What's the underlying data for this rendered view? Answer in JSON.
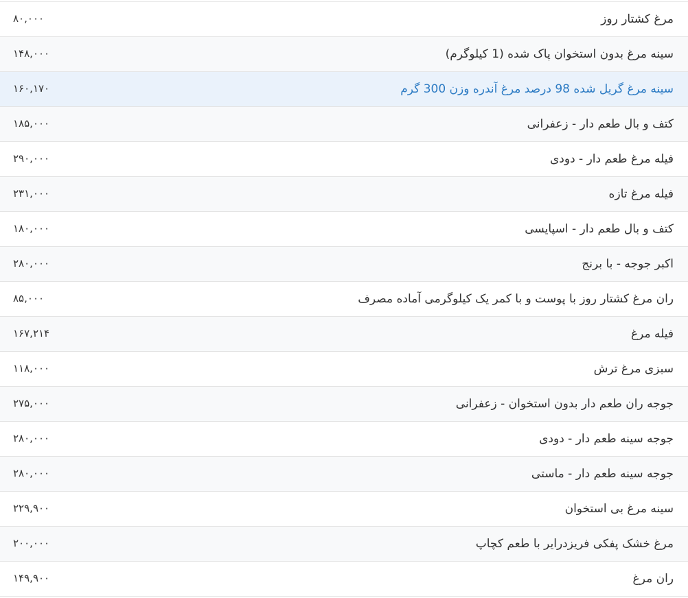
{
  "products": [
    {
      "name": "مرغ کشتار روز",
      "price": "۸۰,۰۰۰",
      "highlighted": false
    },
    {
      "name": "سینه مرغ بدون استخوان پاک شده (1 کیلوگرم)",
      "price": "۱۴۸,۰۰۰",
      "highlighted": false
    },
    {
      "name": "سینه مرغ گریل شده 98 درصد مرغ آندره وزن 300 گرم",
      "price": "۱۶۰,۱۷۰",
      "highlighted": true
    },
    {
      "name": "کتف و بال طعم دار - زعفرانی",
      "price": "۱۸۵,۰۰۰",
      "highlighted": false
    },
    {
      "name": "فیله مرغ طعم دار - دودی",
      "price": "۲۹۰,۰۰۰",
      "highlighted": false
    },
    {
      "name": "فیله مرغ تازه",
      "price": "۲۳۱,۰۰۰",
      "highlighted": false
    },
    {
      "name": "کتف و بال طعم دار - اسپایسی",
      "price": "۱۸۰,۰۰۰",
      "highlighted": false
    },
    {
      "name": "اکبر جوجه - با برنج",
      "price": "۲۸۰,۰۰۰",
      "highlighted": false
    },
    {
      "name": "ران مرغ کشتار روز با پوست و با کمر یک کیلوگرمی آماده مصرف",
      "price": "۸۵,۰۰۰",
      "highlighted": false
    },
    {
      "name": "فیله مرغ",
      "price": "۱۶۷,۲۱۴",
      "highlighted": false
    },
    {
      "name": "سبزی مرغ ترش",
      "price": "۱۱۸,۰۰۰",
      "highlighted": false
    },
    {
      "name": "جوجه ران طعم دار بدون استخوان - زعفرانی",
      "price": "۲۷۵,۰۰۰",
      "highlighted": false
    },
    {
      "name": "جوجه سینه طعم دار - دودی",
      "price": "۲۸۰,۰۰۰",
      "highlighted": false
    },
    {
      "name": "جوجه سینه طعم دار - ماستی",
      "price": "۲۸۰,۰۰۰",
      "highlighted": false
    },
    {
      "name": "سینه مرغ بی استخوان",
      "price": "۲۲۹,۹۰۰",
      "highlighted": false
    },
    {
      "name": "مرغ خشک پفکی فریزدرایر با طعم کچاپ",
      "price": "۲۰۰,۰۰۰",
      "highlighted": false
    },
    {
      "name": "ران مرغ",
      "price": "۱۴۹,۹۰۰",
      "highlighted": false
    }
  ],
  "colors": {
    "link": "#2e7cc4",
    "text": "#333333",
    "stripe": "#f8f9fa",
    "highlight": "#eaf2fb",
    "border": "#e4e4e4"
  }
}
